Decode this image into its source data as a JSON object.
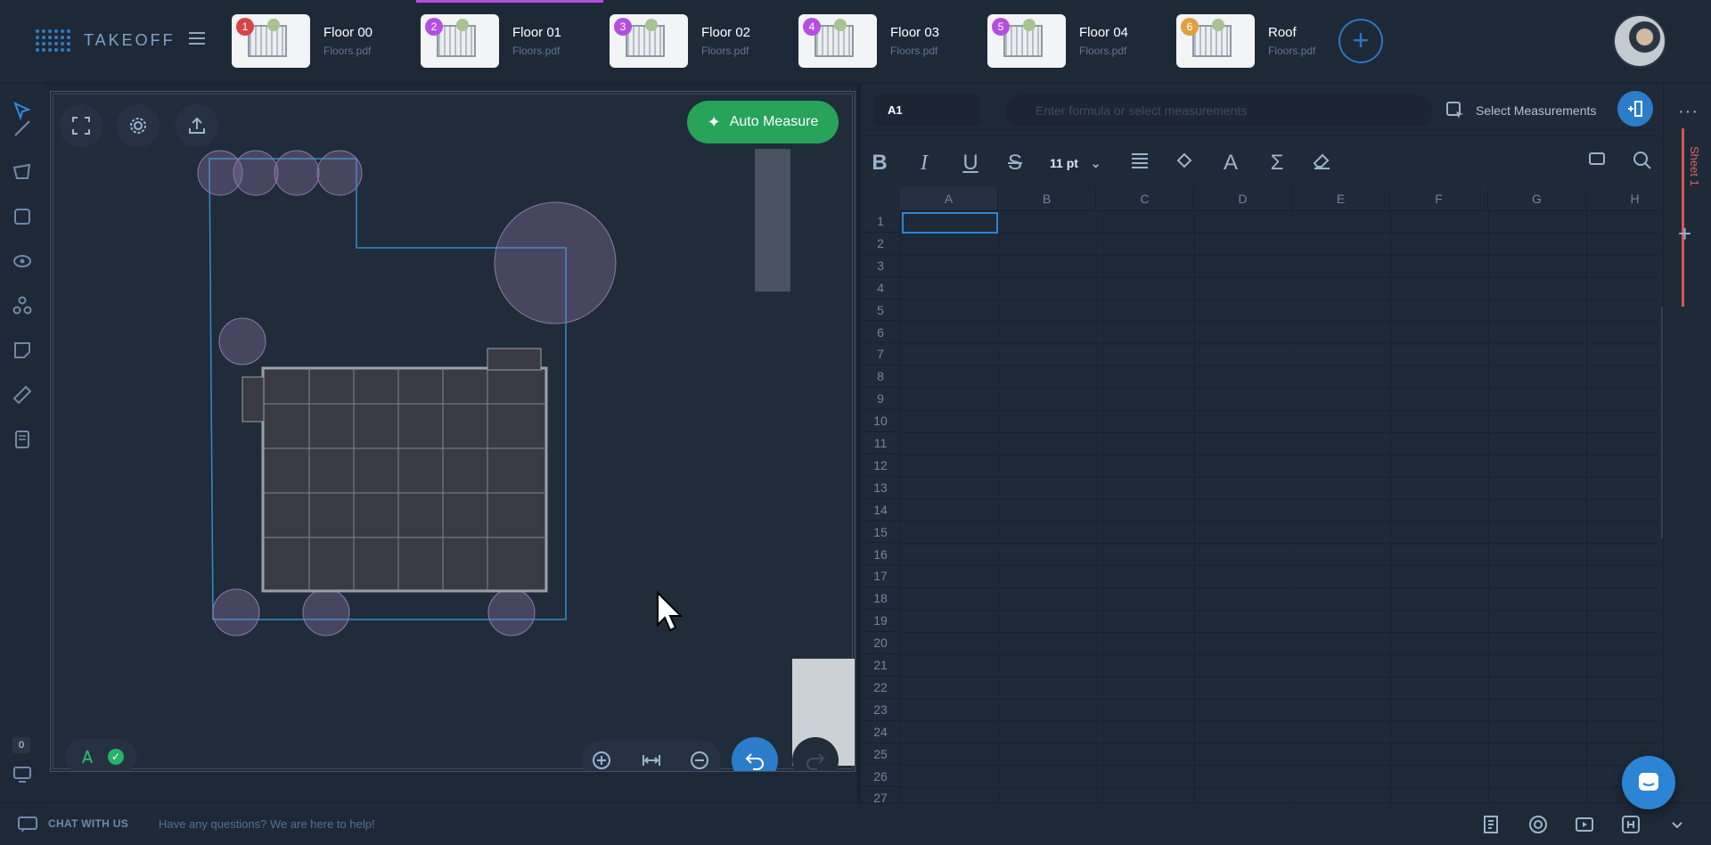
{
  "app": {
    "name": "TAKEOFF"
  },
  "tabs": [
    {
      "badge": "1",
      "badge_color": "#d64545",
      "name": "Floor 00",
      "file": "Floors.pdf",
      "active": false
    },
    {
      "badge": "2",
      "badge_color": "#b44fe0",
      "name": "Floor 01",
      "file": "Floors.pdf",
      "active": true
    },
    {
      "badge": "3",
      "badge_color": "#b44fe0",
      "name": "Floor 02",
      "file": "Floors.pdf",
      "active": false
    },
    {
      "badge": "4",
      "badge_color": "#b44fe0",
      "name": "Floor 03",
      "file": "Floors.pdf",
      "active": false
    },
    {
      "badge": "5",
      "badge_color": "#b44fe0",
      "name": "Floor 04",
      "file": "Floors.pdf",
      "active": false
    },
    {
      "badge": "6",
      "badge_color": "#e0a040",
      "name": "Roof",
      "file": "Floors.pdf",
      "active": false
    }
  ],
  "canvas": {
    "auto_measure_label": "Auto Measure"
  },
  "left_tools": [
    "select-icon",
    "line-icon",
    "polygon-icon",
    "rectangle-icon",
    "eye-scan-icon",
    "group-icon",
    "note-icon",
    "ruler-icon",
    "book-icon"
  ],
  "left_counter": "0",
  "sheet": {
    "cell_ref": "A1",
    "formula_placeholder": "Enter formula or select measurements",
    "select_measurements_label": "Select Measurements",
    "font_size": "11 pt",
    "columns": [
      "A",
      "B",
      "C",
      "D",
      "E",
      "F",
      "G",
      "H"
    ],
    "rows": [
      "1",
      "2",
      "3",
      "4",
      "5",
      "6",
      "7",
      "8",
      "9",
      "10",
      "11",
      "12",
      "13",
      "14",
      "15",
      "16",
      "17",
      "18",
      "19",
      "20",
      "21",
      "22",
      "23",
      "24",
      "25",
      "26",
      "27"
    ],
    "sheet_tab": "Sheet 1"
  },
  "bottom": {
    "chat_label": "CHAT WITH US",
    "chat_placeholder": "Have any questions? We are here to help!"
  },
  "colors": {
    "accent": "#2b7dc9",
    "success": "#27a35a",
    "tab_active": "#b44fe0",
    "sheet_tab": "#d9534f"
  }
}
